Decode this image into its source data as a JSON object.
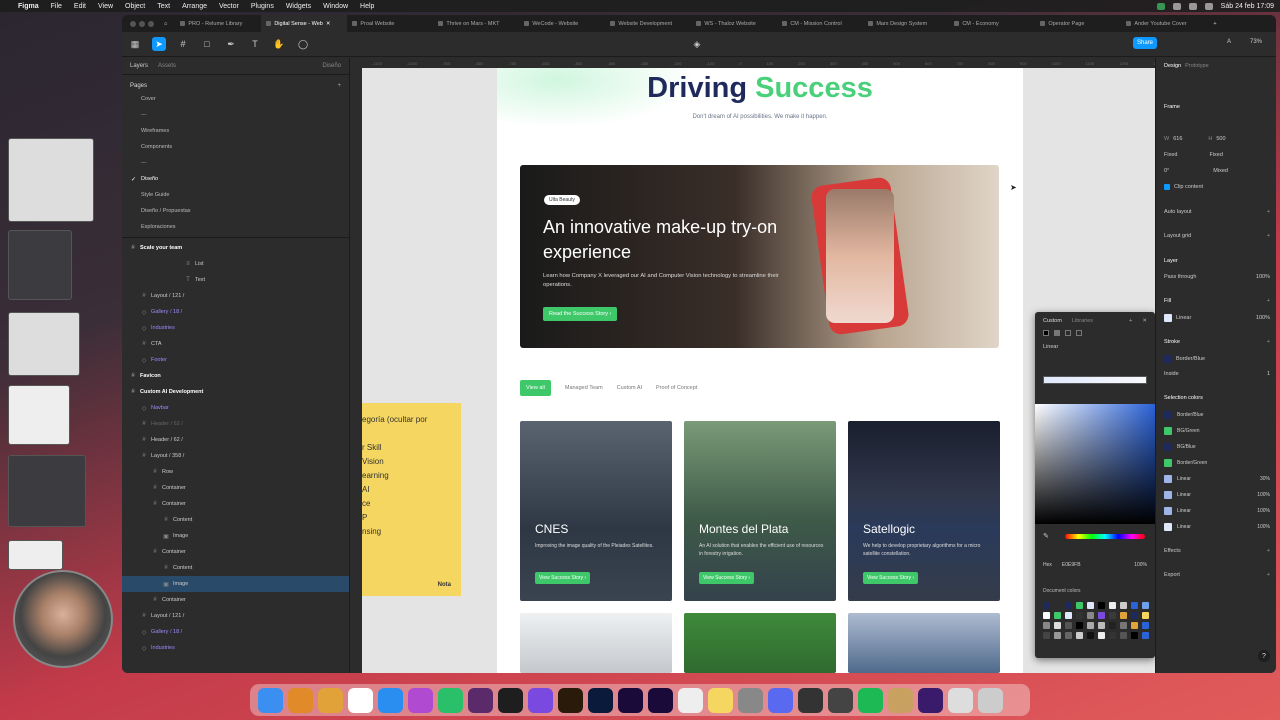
{
  "menubar": {
    "app": "Figma",
    "items": [
      "File",
      "Edit",
      "View",
      "Object",
      "Text",
      "Arrange",
      "Vector",
      "Plugins",
      "Widgets",
      "Window",
      "Help"
    ],
    "datetime": "Sáb 24 feb  17:09"
  },
  "tabs": [
    {
      "label": "PRO - Relume Library",
      "active": false
    },
    {
      "label": "Digital Sense - Web",
      "active": true
    },
    {
      "label": "Proal Website",
      "active": false
    },
    {
      "label": "Thrive on Mars - MKT",
      "active": false
    },
    {
      "label": "WeCode - Website",
      "active": false
    },
    {
      "label": "Website Development",
      "active": false
    },
    {
      "label": "WS - Thaloz Website",
      "active": false
    },
    {
      "label": "CM - Mission Control",
      "active": false
    },
    {
      "label": "Mars Design System",
      "active": false
    },
    {
      "label": "CM - Economy",
      "active": false
    },
    {
      "label": "Operator Page",
      "active": false
    },
    {
      "label": "Ander Youtube Cover",
      "active": false
    }
  ],
  "toolbar": {
    "share_label": "Share",
    "zoom": "73%",
    "initial": "A"
  },
  "leftpanel": {
    "tab_layers": "Layers",
    "tab_assets": "Assets",
    "page_switch": "Diseño",
    "pages_title": "Pages",
    "pages": [
      "Cover",
      "---",
      "Wireframes",
      "Components",
      "---",
      "Diseño",
      "Style Guide",
      "Diseño / Propuestas",
      "Exploraciones"
    ],
    "current_page": "Diseño",
    "layers": [
      {
        "label": "Scale your team",
        "indent": 0,
        "style": "bold",
        "icon": "#"
      },
      {
        "label": "List",
        "indent": 5,
        "style": "",
        "icon": "≡"
      },
      {
        "label": "Text",
        "indent": 5,
        "style": "",
        "icon": "T"
      },
      {
        "label": "Layout / 121 /",
        "indent": 1,
        "style": "",
        "icon": "#"
      },
      {
        "label": "Gallery / 18 /",
        "indent": 1,
        "style": "purple",
        "icon": "◇"
      },
      {
        "label": "Industries",
        "indent": 1,
        "style": "purple",
        "icon": "◇"
      },
      {
        "label": "CTA",
        "indent": 1,
        "style": "",
        "icon": "#"
      },
      {
        "label": "Footer",
        "indent": 1,
        "style": "purple",
        "icon": "◇"
      },
      {
        "label": "Favicon",
        "indent": 0,
        "style": "bold",
        "icon": "#"
      },
      {
        "label": "Custom AI Development",
        "indent": 0,
        "style": "bold",
        "icon": "#"
      },
      {
        "label": "Navbar",
        "indent": 1,
        "style": "purple",
        "icon": "◇"
      },
      {
        "label": "Header / 62 /",
        "indent": 1,
        "style": "dim",
        "icon": "#"
      },
      {
        "label": "Header / 62 /",
        "indent": 1,
        "style": "",
        "icon": "#"
      },
      {
        "label": "Layout / 358 /",
        "indent": 1,
        "style": "",
        "icon": "#"
      },
      {
        "label": "Row",
        "indent": 2,
        "style": "",
        "icon": "#"
      },
      {
        "label": "Container",
        "indent": 2,
        "style": "",
        "icon": "#"
      },
      {
        "label": "Container",
        "indent": 2,
        "style": "",
        "icon": "#"
      },
      {
        "label": "Content",
        "indent": 3,
        "style": "",
        "icon": "#"
      },
      {
        "label": "Image",
        "indent": 3,
        "style": "",
        "icon": "▣"
      },
      {
        "label": "Container",
        "indent": 2,
        "style": "",
        "icon": "#"
      },
      {
        "label": "Content",
        "indent": 3,
        "style": "",
        "icon": "#"
      },
      {
        "label": "Image",
        "indent": 3,
        "style": "selected",
        "icon": "▣"
      },
      {
        "label": "Container",
        "indent": 2,
        "style": "",
        "icon": "#"
      },
      {
        "label": "Layout / 121 /",
        "indent": 1,
        "style": "",
        "icon": "#"
      },
      {
        "label": "Gallery / 18 /",
        "indent": 1,
        "style": "purple",
        "icon": "◇"
      },
      {
        "label": "Industries",
        "indent": 1,
        "style": "purple",
        "icon": "◇"
      }
    ]
  },
  "ruler_ticks": [
    "-1100",
    "-1000",
    "-900",
    "-800",
    "-700",
    "-600",
    "-500",
    "-400",
    "-300",
    "-200",
    "-100",
    "0",
    "100",
    "200",
    "300",
    "400",
    "500",
    "600",
    "700",
    "800",
    "900",
    "1000",
    "1100",
    "1200",
    "1300"
  ],
  "canvas": {
    "hero_title_a": "Driving ",
    "hero_title_b": "Success",
    "hero_sub": "Don't dream of AI possibilities. We make it happen.",
    "feature": {
      "badge": "Ulta Beauty",
      "title": "An innovative make-up try-on experience",
      "desc": "Learn how Company X leveraged our AI and Computer Vision technology to streamline their operations.",
      "button": "Read the Success Story"
    },
    "filters": [
      "View all",
      "Managed Team",
      "Custom AI",
      "Proof of Concept"
    ],
    "cards": [
      {
        "title": "CNES",
        "desc": "Improving the image quality of the Pleiades Satellites.",
        "button": "View Success Story"
      },
      {
        "title": "Montes del Plata",
        "desc": "An AI solution that enables the efficient use of resources in forestry irrigation.",
        "button": "View Success Story"
      },
      {
        "title": "Satellogic",
        "desc": "We help to develop proprietary algorithms for a micro satellite constellation.",
        "button": "View Success Story"
      }
    ],
    "note": {
      "lines": [
        "egoría (ocultar por",
        "",
        "r Skill",
        "Vision",
        "earning",
        "AI",
        "ce",
        "P",
        "nsing"
      ],
      "label": "Nota"
    }
  },
  "picker": {
    "tab_custom": "Custom",
    "tab_libraries": "Libraries",
    "mode": "Linear",
    "hex_label": "Hex",
    "hex": "E0E9FB",
    "opacity": "100%",
    "doc_colors": "Document colors"
  },
  "rightpanel": {
    "tab_design": "Design",
    "tab_prototype": "Prototype",
    "frame_label": "Frame",
    "w": "616",
    "h": "500",
    "fixed_w": "Fixed",
    "fixed_h": "Fixed",
    "rotation": "0°",
    "radius": "Mixed",
    "clip": "Clip content",
    "auto_layout": "Auto layout",
    "layout_grid": "Layout grid",
    "layer": "Layer",
    "pass": "Pass through",
    "layer_op": "100%",
    "fill": "Fill",
    "fill_type": "Linear",
    "fill_op": "100%",
    "stroke": "Stroke",
    "stroke_color": "Border/Blue",
    "inside": "Inside",
    "stroke_w": "1",
    "sel_colors": "Selection colors",
    "colors": [
      {
        "name": "Border/Blue",
        "hex": "#1f2a5c",
        "val": ""
      },
      {
        "name": "BG/Green",
        "hex": "#3fc86a",
        "val": ""
      },
      {
        "name": "BG/Blue",
        "hex": "#1f2a5c",
        "val": ""
      },
      {
        "name": "Border/Green",
        "hex": "#3fc86a",
        "val": ""
      },
      {
        "name": "Linear",
        "hex": "#9fb4e8",
        "val": "30%"
      },
      {
        "name": "Linear",
        "hex": "#9fb4e8",
        "val": "100%"
      },
      {
        "name": "Linear",
        "hex": "#9fb4e8",
        "val": "100%"
      },
      {
        "name": "Linear",
        "hex": "#e0e9fb",
        "val": "100%"
      }
    ],
    "effects": "Effects",
    "export": "Export"
  }
}
